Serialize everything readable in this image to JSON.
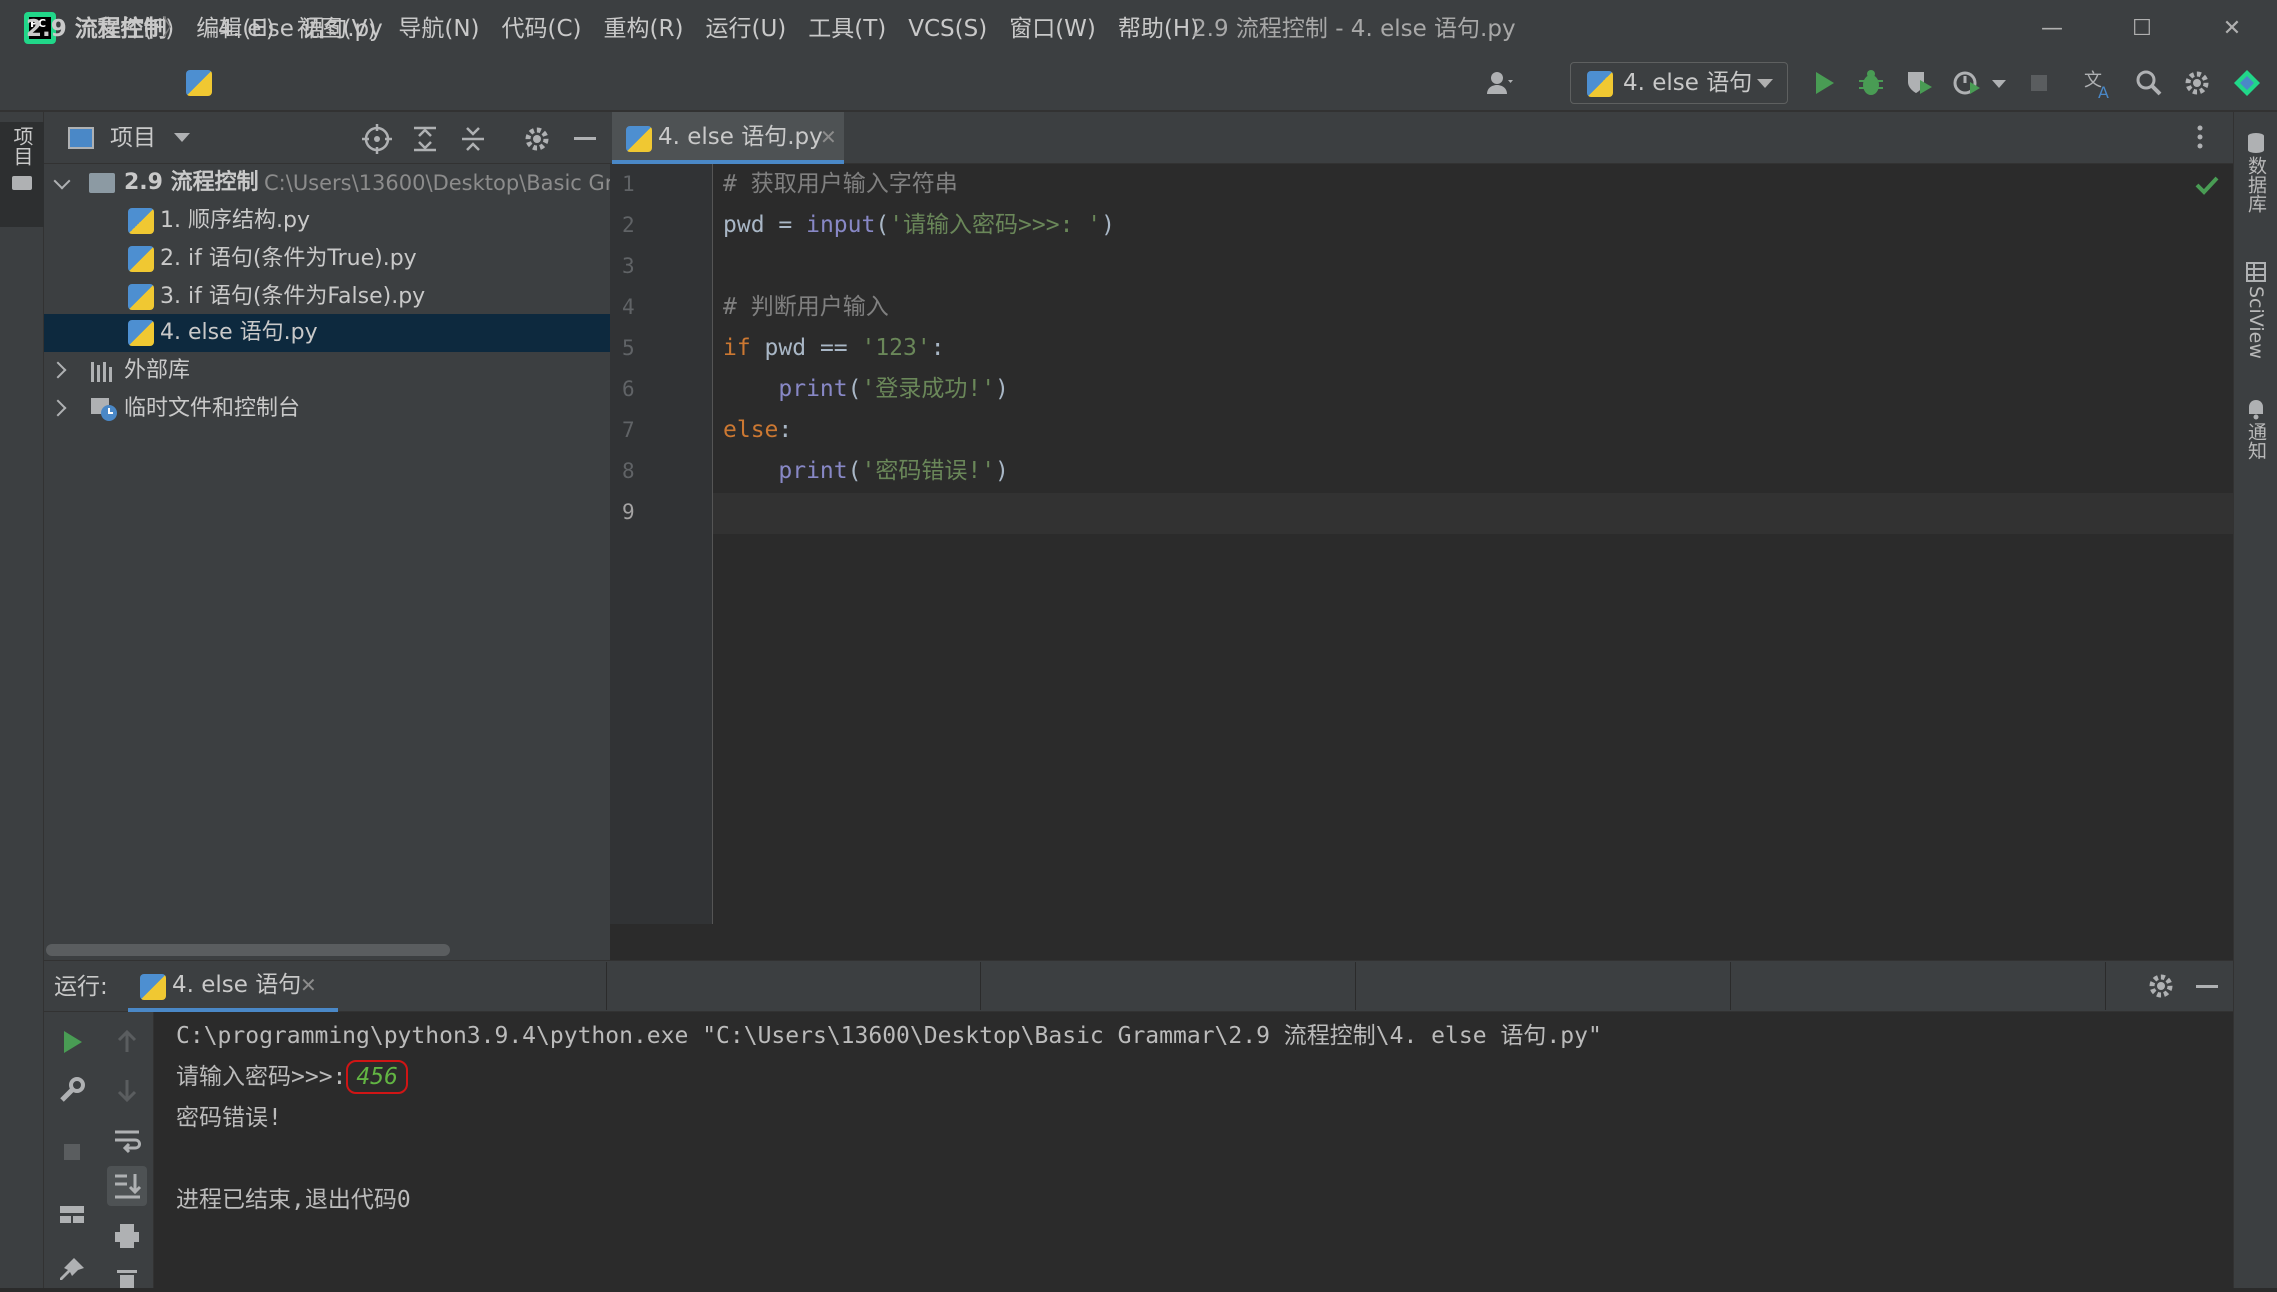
{
  "titlebar": {
    "logo_text": "PC",
    "menu": [
      "文件(F)",
      "编辑(E)",
      "视图(V)",
      "导航(N)",
      "代码(C)",
      "重构(R)",
      "运行(U)",
      "工具(T)",
      "VCS(S)",
      "窗口(W)",
      "帮助(H)"
    ],
    "window_title": "2.9 流程控制 - 4. else 语句.py",
    "minimize": "—",
    "maximize": "☐",
    "close": "✕"
  },
  "navbar": {
    "breadcrumb_project": "2.9 流程控制",
    "breadcrumb_separator": "〉",
    "breadcrumb_file": "4. else 语句.py",
    "run_config": "4. else 语句"
  },
  "left_stripe": {
    "project_label": "项目"
  },
  "project_panel": {
    "title": "项目",
    "root": {
      "name": "2.9 流程控制",
      "path": "C:\\Users\\13600\\Desktop\\Basic Gr"
    },
    "files": [
      "1. 顺序结构.py",
      "2. if 语句(条件为True).py",
      "3. if 语句(条件为False).py",
      "4. else 语句.py"
    ],
    "selected_index": 3,
    "external_libs": "外部库",
    "scratches": "临时文件和控制台"
  },
  "editor": {
    "tab_label": "4. else 语句.py",
    "line_numbers": [
      "1",
      "2",
      "3",
      "4",
      "5",
      "6",
      "7",
      "8",
      "9"
    ],
    "current_line": "9",
    "code": {
      "l1_comment": "# 获取用户输入字符串",
      "l2_var": "pwd = ",
      "l2_func": "input",
      "l2_open": "(",
      "l2_str": "'请输入密码>>>: '",
      "l2_close": ")",
      "l4_comment": "# 判断用户输入",
      "l5_kw": "if",
      "l5_mid": " pwd == ",
      "l5_str": "'123'",
      "l5_end": ":",
      "l6_indent": "    ",
      "l6_func": "print",
      "l6_open": "(",
      "l6_str": "'登录成功!'",
      "l6_close": ")",
      "l7_kw": "else",
      "l7_end": ":",
      "l8_indent": "    ",
      "l8_func": "print",
      "l8_open": "(",
      "l8_str": "'密码错误!'",
      "l8_close": ")"
    }
  },
  "right_stripe": {
    "database": "数据库",
    "sciview": "SciView",
    "notifications": "通知"
  },
  "run_panel": {
    "label": "运行:",
    "tab_label": "4. else 语句",
    "console": {
      "command": "C:\\programming\\python3.9.4\\python.exe \"C:\\Users\\13600\\Desktop\\Basic Grammar\\2.9 流程控制\\4. else 语句.py\"",
      "prompt": "请输入密码>>>:",
      "input_value": "456",
      "output": "密码错误!",
      "exit": "进程已结束,退出代码0"
    }
  },
  "colors": {
    "accent": "#4a88c7",
    "run_green": "#499c54",
    "keyword": "#cc7832",
    "string": "#6a8759",
    "builtin": "#8888c6",
    "comment": "#808080",
    "input_green": "#62b543",
    "input_border": "#d01515"
  }
}
